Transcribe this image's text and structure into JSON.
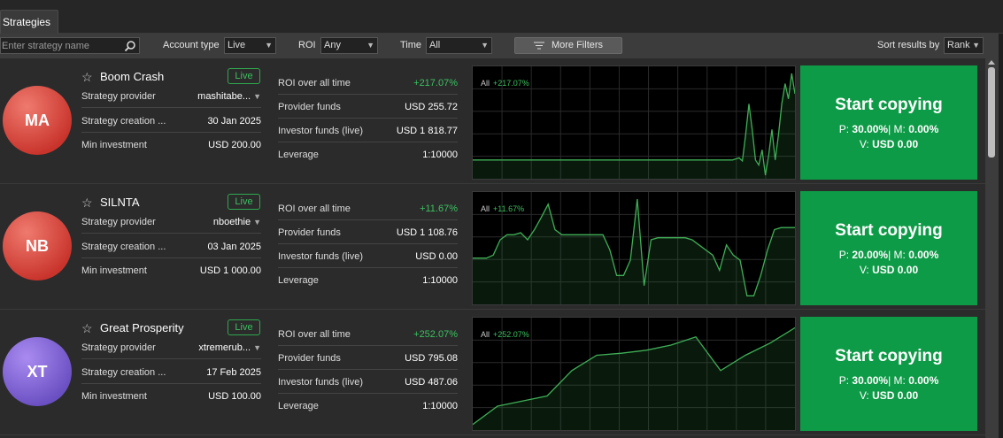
{
  "tabs": {
    "active": "Strategies"
  },
  "filters": {
    "search_placeholder": "Enter strategy name",
    "account_type_label": "Account type",
    "account_type_value": "Live",
    "roi_label": "ROI",
    "roi_value": "Any",
    "time_label": "Time",
    "time_value": "All",
    "more_filters_label": "More Filters",
    "sort_label": "Sort results by",
    "sort_value": "Rank"
  },
  "labels": {
    "provider": "Strategy provider",
    "creation": "Strategy creation ...",
    "min_investment": "Min investment",
    "roi_all_time": "ROI over all time",
    "provider_funds": "Provider funds",
    "investor_funds": "Investor funds (live)",
    "leverage": "Leverage",
    "badge": "Live",
    "chart_period": "All",
    "copy_title": "Start copying",
    "p_label": "P:",
    "m_label": "| M:",
    "v_label": "V:"
  },
  "strategies": [
    {
      "initials": "MA",
      "avatar_color": "#c8332b",
      "name": "Boom Crash",
      "provider": "mashitabe...",
      "creation": "30 Jan 2025",
      "min_investment": "USD 200.00",
      "roi": "+217.07%",
      "provider_funds": "USD 255.72",
      "investor_funds": "USD 1 818.77",
      "leverage": "1:10000",
      "chart_roi": "+217.07%",
      "p": "30.00%",
      "m": "0.00%",
      "v": "USD 0.00",
      "series": [
        0.85,
        0.85,
        0.85,
        0.85,
        0.85,
        0.85,
        0.85,
        0.85,
        0.85,
        0.85,
        0.85,
        0.85,
        0.85,
        0.85,
        0.85,
        0.85,
        0.85,
        0.85,
        0.85,
        0.85,
        0.85,
        0.85,
        0.85,
        0.85,
        0.85,
        0.85,
        0.85,
        0.85,
        0.85,
        0.85,
        0.85,
        0.85,
        0.85,
        0.85,
        0.85,
        0.85,
        0.85,
        0.85,
        0.85,
        0.85,
        0.85,
        0.85,
        0.85,
        0.85,
        0.85,
        0.85,
        0.85,
        0.85,
        0.85,
        0.85,
        0.85,
        0.85,
        0.85,
        0.85,
        0.85,
        0.85,
        0.85,
        0.85,
        0.85,
        0.85,
        0.85,
        0.85,
        0.85,
        0.85,
        0.85,
        0.85,
        0.85,
        0.85,
        0.85,
        0.85,
        0.85,
        0.85,
        0.85,
        0.85,
        0.85,
        0.85,
        0.85,
        0.85,
        0.85,
        0.85,
        0.84,
        0.83,
        0.86,
        0.6,
        0.3,
        0.55,
        0.85,
        0.9,
        0.75,
        1.0,
        0.8,
        0.55,
        0.85,
        0.6,
        0.3,
        0.1,
        0.25,
        0.0,
        0.2
      ]
    },
    {
      "initials": "NB",
      "avatar_color": "#c8332b",
      "name": "SILNTA",
      "provider": "nboethie",
      "creation": "03 Jan 2025",
      "min_investment": "USD 1 000.00",
      "roi": "+11.67%",
      "provider_funds": "USD 1 108.76",
      "investor_funds": "USD 0.00",
      "leverage": "1:10000",
      "chart_roi": "+11.67%",
      "p": "20.00%",
      "m": "0.00%",
      "v": "USD 0.00",
      "series": [
        0.58,
        0.58,
        0.58,
        0.55,
        0.4,
        0.35,
        0.35,
        0.33,
        0.4,
        0.3,
        0.18,
        0.05,
        0.3,
        0.35,
        0.35,
        0.35,
        0.35,
        0.35,
        0.35,
        0.35,
        0.5,
        0.75,
        0.75,
        0.6,
        0.0,
        0.85,
        0.4,
        0.38,
        0.38,
        0.38,
        0.38,
        0.38,
        0.4,
        0.45,
        0.5,
        0.55,
        0.7,
        0.45,
        0.55,
        0.6,
        0.95,
        0.95,
        0.75,
        0.5,
        0.3,
        0.28,
        0.28,
        0.28
      ]
    },
    {
      "initials": "XT",
      "avatar_color": "#6a4fc2",
      "name": "Great Prosperity",
      "provider": "xtremerub...",
      "creation": "17 Feb 2025",
      "min_investment": "USD 100.00",
      "roi": "+252.07%",
      "provider_funds": "USD 795.08",
      "investor_funds": "USD 487.06",
      "leverage": "1:10000",
      "chart_roi": "+252.07%",
      "p": "30.00%",
      "m": "0.00%",
      "v": "USD 0.00",
      "series": [
        0.98,
        0.8,
        0.75,
        0.7,
        0.45,
        0.3,
        0.28,
        0.25,
        0.2,
        0.12,
        0.45,
        0.3,
        0.18,
        0.03
      ]
    }
  ]
}
